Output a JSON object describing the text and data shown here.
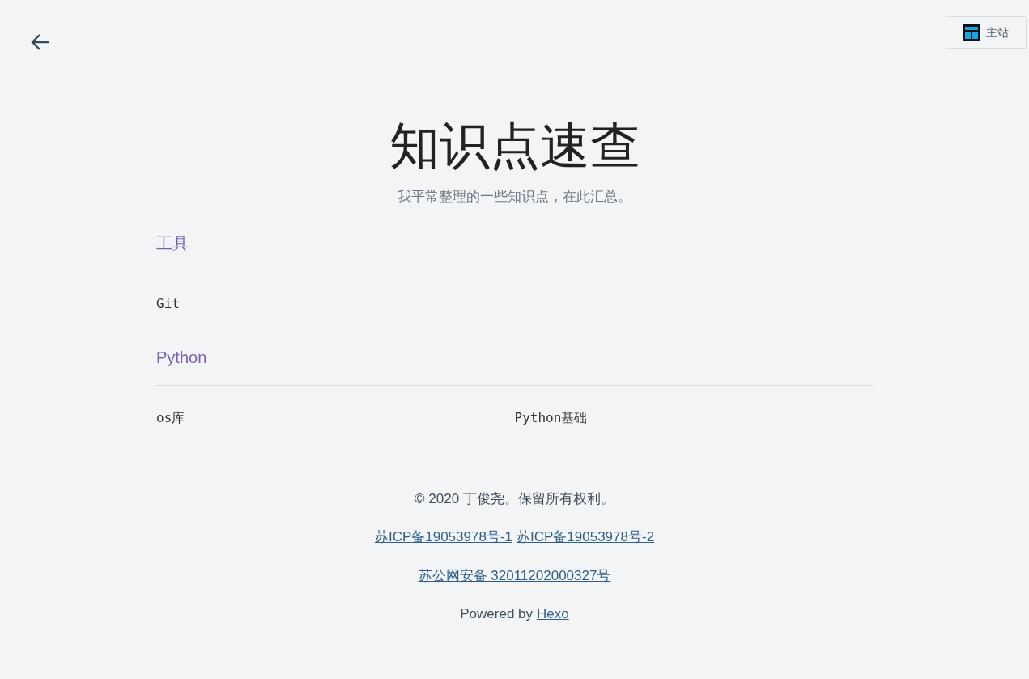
{
  "home_button": {
    "label": "主站"
  },
  "title": "知识点速查",
  "subtitle": "我平常整理的一些知识点，在此汇总。",
  "sections": [
    {
      "heading": "工具",
      "items": [
        "Git"
      ]
    },
    {
      "heading": "Python",
      "items": [
        "os库",
        "Python基础"
      ]
    }
  ],
  "footer": {
    "copyright": "© 2020 丁俊尧。保留所有权利。",
    "icp_links": [
      "苏ICP备19053978号-1",
      "苏ICP备19053978号-2"
    ],
    "police_link": "苏公网安备 32011202000327号",
    "powered_by": "Powered by",
    "powered_link": "Hexo"
  }
}
